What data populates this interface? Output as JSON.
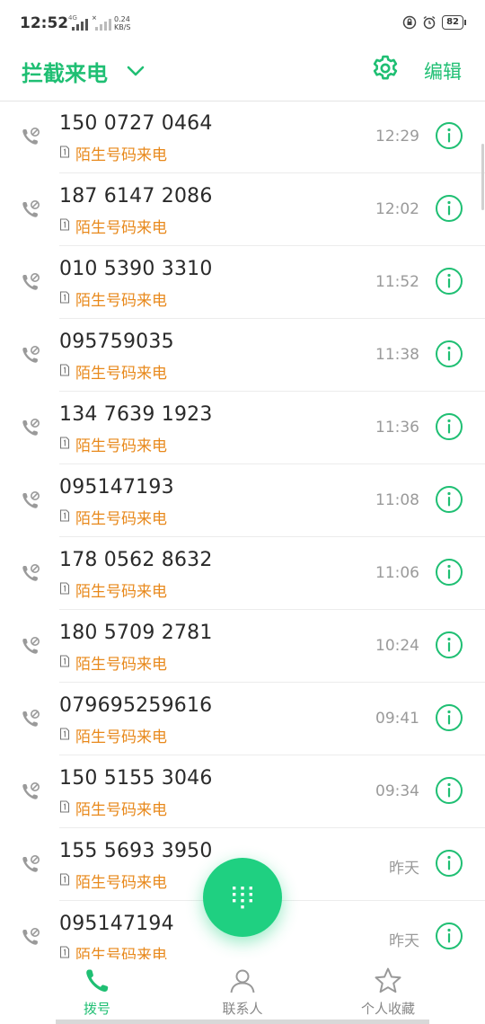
{
  "status_bar": {
    "time": "12:52",
    "network": "4G",
    "speed_value": "0.24",
    "speed_unit": "KB/S",
    "battery": "82"
  },
  "header": {
    "title": "拦截来电",
    "edit_label": "编辑"
  },
  "calls": [
    {
      "number": "150 0727 0464",
      "tag": "陌生号码来电",
      "time": "12:29"
    },
    {
      "number": "187 6147 2086",
      "tag": "陌生号码来电",
      "time": "12:02"
    },
    {
      "number": "010 5390 3310",
      "tag": "陌生号码来电",
      "time": "11:52"
    },
    {
      "number": "095759035",
      "tag": "陌生号码来电",
      "time": "11:38"
    },
    {
      "number": "134 7639 1923",
      "tag": "陌生号码来电",
      "time": "11:36"
    },
    {
      "number": "095147193",
      "tag": "陌生号码来电",
      "time": "11:08"
    },
    {
      "number": "178 0562 8632",
      "tag": "陌生号码来电",
      "time": "11:06"
    },
    {
      "number": "180 5709 2781",
      "tag": "陌生号码来电",
      "time": "10:24"
    },
    {
      "number": "079695259616",
      "tag": "陌生号码来电",
      "time": "09:41"
    },
    {
      "number": "150 5155 3046",
      "tag": "陌生号码来电",
      "time": "09:34"
    },
    {
      "number": "155 5693 3950",
      "tag": "陌生号码来电",
      "time": "昨天"
    },
    {
      "number": "095147194",
      "tag": "陌生号码来电",
      "time": "昨天"
    }
  ],
  "bottom_nav": {
    "dial": "拨号",
    "contacts": "联系人",
    "favorites": "个人收藏"
  },
  "colors": {
    "accent": "#1fbf73",
    "tag": "#e8891c"
  }
}
